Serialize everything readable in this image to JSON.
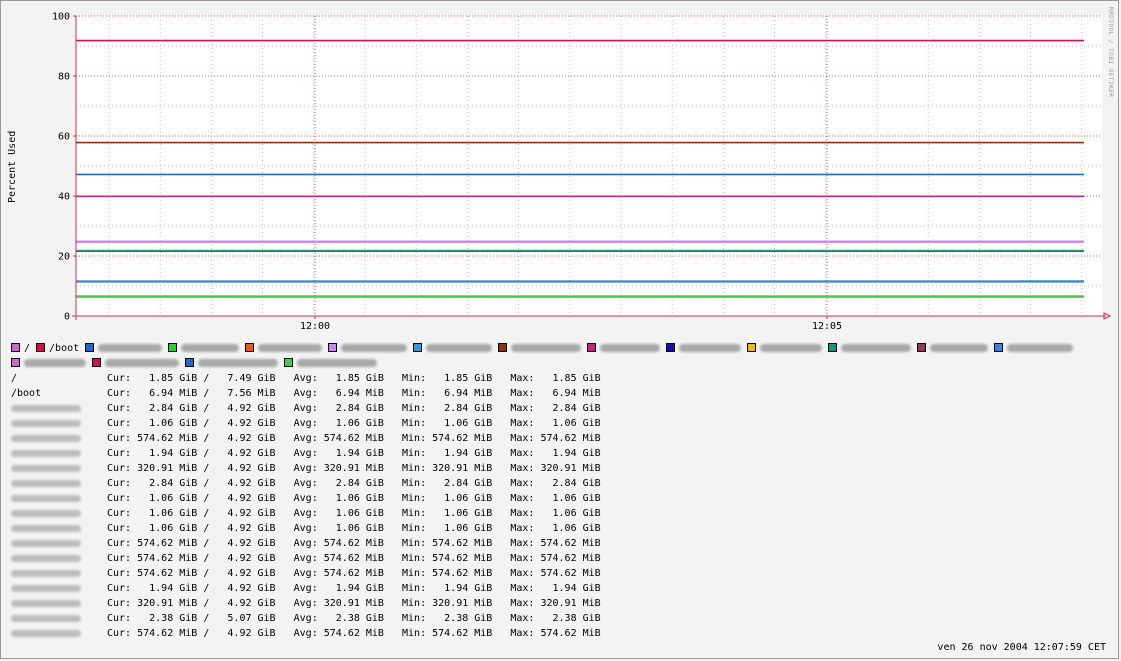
{
  "chart_data": {
    "type": "line",
    "title": "",
    "xlabel": "",
    "ylabel": "Percent Used",
    "ylim": [
      0,
      100
    ],
    "y_ticks": [
      "0",
      "20",
      "40",
      "60",
      "80",
      "100"
    ],
    "x_ticks": [
      "12:00",
      "12:05"
    ],
    "grid": true,
    "legend": "bottom",
    "series": [
      {
        "name": "/",
        "color": "#cc66cc",
        "value": 24.7
      },
      {
        "name": "/boot",
        "color": "#cc1155",
        "value": 91.8
      },
      {
        "name": "",
        "color": "#2266cc",
        "value": 47.2
      },
      {
        "name": "",
        "color": "#33cc33",
        "value": 11.6,
        "start_fraction": 0.92
      },
      {
        "name": "",
        "color": "#ee5522",
        "value": 11.6
      },
      {
        "name": "",
        "color": "#cc88ee",
        "value": 24.9
      },
      {
        "name": "",
        "color": "#3399dd",
        "value": 11.6
      },
      {
        "name": "",
        "color": "#883311",
        "value": 57.8
      },
      {
        "name": "",
        "color": "#cc2288",
        "value": 39.9
      },
      {
        "name": "",
        "color": "#1111aa",
        "value": 21.6
      },
      {
        "name": "",
        "color": "#eebb11",
        "value": 21.9
      },
      {
        "name": "",
        "color": "#119988",
        "value": 21.7
      },
      {
        "name": "",
        "color": "#993366",
        "value": 6.5
      },
      {
        "name": "",
        "color": "#3388dd",
        "value": 11.4
      },
      {
        "name": "",
        "color": "#cc66cc",
        "value": 6.6
      },
      {
        "name": "",
        "color": "#cc1155",
        "value": 6.4
      },
      {
        "name": "",
        "color": "#2266cc",
        "value": 6.5
      },
      {
        "name": "",
        "color": "#44cc44",
        "value": 6.5
      }
    ]
  },
  "stats": [
    {
      "label": "/",
      "text": "Cur:   1.85 GiB /   7.49 GiB   Avg:   1.85 GiB   Min:   1.85 GiB   Max:   1.85 GiB"
    },
    {
      "label": "/boot",
      "text": "Cur:   6.94 MiB /   7.56 MiB   Avg:   6.94 MiB   Min:   6.94 MiB   Max:   6.94 MiB"
    },
    {
      "label": "",
      "text": "Cur:   2.84 GiB /   4.92 GiB   Avg:   2.84 GiB   Min:   2.84 GiB   Max:   2.84 GiB"
    },
    {
      "label": "",
      "text": "Cur:   1.06 GiB /   4.92 GiB   Avg:   1.06 GiB   Min:   1.06 GiB   Max:   1.06 GiB"
    },
    {
      "label": "",
      "text": "Cur: 574.62 MiB /   4.92 GiB   Avg: 574.62 MiB   Min: 574.62 MiB   Max: 574.62 MiB"
    },
    {
      "label": "",
      "text": "Cur:   1.94 GiB /   4.92 GiB   Avg:   1.94 GiB   Min:   1.94 GiB   Max:   1.94 GiB"
    },
    {
      "label": "",
      "text": "Cur: 320.91 MiB /   4.92 GiB   Avg: 320.91 MiB   Min: 320.91 MiB   Max: 320.91 MiB"
    },
    {
      "label": "",
      "text": "Cur:   2.84 GiB /   4.92 GiB   Avg:   2.84 GiB   Min:   2.84 GiB   Max:   2.84 GiB"
    },
    {
      "label": "",
      "text": "Cur:   1.06 GiB /   4.92 GiB   Avg:   1.06 GiB   Min:   1.06 GiB   Max:   1.06 GiB"
    },
    {
      "label": "",
      "text": "Cur:   1.06 GiB /   4.92 GiB   Avg:   1.06 GiB   Min:   1.06 GiB   Max:   1.06 GiB"
    },
    {
      "label": "",
      "text": "Cur:   1.06 GiB /   4.92 GiB   Avg:   1.06 GiB   Min:   1.06 GiB   Max:   1.06 GiB"
    },
    {
      "label": "",
      "text": "Cur: 574.62 MiB /   4.92 GiB   Avg: 574.62 MiB   Min: 574.62 MiB   Max: 574.62 MiB"
    },
    {
      "label": "",
      "text": "Cur: 574.62 MiB /   4.92 GiB   Avg: 574.62 MiB   Min: 574.62 MiB   Max: 574.62 MiB"
    },
    {
      "label": "",
      "text": "Cur: 574.62 MiB /   4.92 GiB   Avg: 574.62 MiB   Min: 574.62 MiB   Max: 574.62 MiB"
    },
    {
      "label": "",
      "text": "Cur:   1.94 GiB /   4.92 GiB   Avg:   1.94 GiB   Min:   1.94 GiB   Max:   1.94 GiB"
    },
    {
      "label": "",
      "text": "Cur: 320.91 MiB /   4.92 GiB   Avg: 320.91 MiB   Min: 320.91 MiB   Max: 320.91 MiB"
    },
    {
      "label": "",
      "text": "Cur:   2.38 GiB /   5.07 GiB   Avg:   2.38 GiB   Min:   2.38 GiB   Max:   2.38 GiB"
    },
    {
      "label": "",
      "text": "Cur: 574.62 MiB /   4.92 GiB   Avg: 574.62 MiB   Min: 574.62 MiB   Max: 574.62 MiB"
    }
  ],
  "watermark": "RRDTOOL / TOBI OETIKER",
  "timestamp": "ven 26 nov 2004 12:07:59 CET"
}
